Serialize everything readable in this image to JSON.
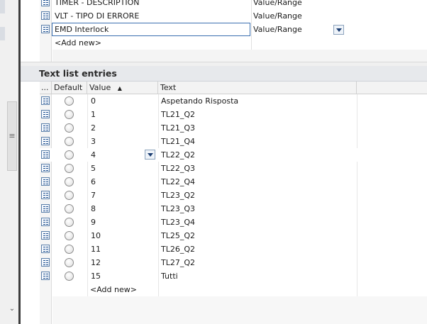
{
  "top_table": {
    "rows": [
      {
        "name": "TIMER - DESCRIPTION",
        "type": "Value/Range"
      },
      {
        "name": "VLT - TIPO DI ERRORE",
        "type": "Value/Range"
      },
      {
        "name": "EMD Interlock",
        "type": "Value/Range"
      }
    ],
    "add_new": "<Add new>"
  },
  "entries_panel": {
    "title": "Text list entries",
    "columns": {
      "more": "...",
      "default": "Default",
      "value": "Value",
      "text": "Text"
    },
    "sort_indicator": "▲",
    "rows": [
      {
        "value": "0",
        "text": "Aspetando Risposta"
      },
      {
        "value": "1",
        "text": "TL21_Q2"
      },
      {
        "value": "2",
        "text": "TL21_Q3"
      },
      {
        "value": "3",
        "text": "TL21_Q4"
      },
      {
        "value": "4",
        "text": "TL22_Q2"
      },
      {
        "value": "5",
        "text": "TL22_Q3"
      },
      {
        "value": "6",
        "text": "TL22_Q4"
      },
      {
        "value": "7",
        "text": "TL23_Q2"
      },
      {
        "value": "8",
        "text": "TL23_Q3"
      },
      {
        "value": "9",
        "text": "TL23_Q4"
      },
      {
        "value": "10",
        "text": "TL25_Q2"
      },
      {
        "value": "11",
        "text": "TL26_Q2"
      },
      {
        "value": "12",
        "text": "TL27_Q2"
      },
      {
        "value": "15",
        "text": "Tutti"
      }
    ],
    "add_new": "<Add new>"
  },
  "icons": {
    "row_icon": "list-entry-icon",
    "dropdown": "chevron-down-icon",
    "scroll_grip": "≡",
    "scroll_down": "⌄"
  },
  "colors": {
    "accent": "#1d3f73",
    "selection_border": "#3a6fb0"
  }
}
